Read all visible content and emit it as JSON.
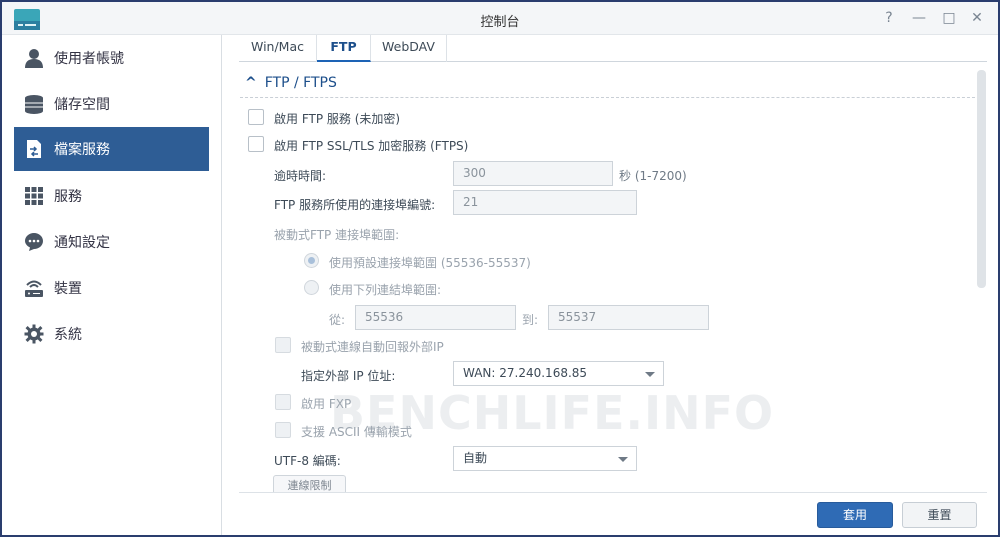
{
  "window": {
    "title": "控制台"
  },
  "window_controls": {
    "help": "?",
    "minimize": "—",
    "maximize": "□",
    "close": "✕"
  },
  "sidebar": {
    "items": [
      {
        "label": "使用者帳號",
        "icon": "user-icon",
        "active": false
      },
      {
        "label": "儲存空間",
        "icon": "storage-icon",
        "active": false
      },
      {
        "label": "檔案服務",
        "icon": "file-services-icon",
        "active": true
      },
      {
        "label": "服務",
        "icon": "services-grid-icon",
        "active": false
      },
      {
        "label": "通知設定",
        "icon": "chat-bubble-icon",
        "active": false
      },
      {
        "label": "裝置",
        "icon": "router-icon",
        "active": false
      },
      {
        "label": "系統",
        "icon": "gear-icon",
        "active": false
      }
    ]
  },
  "tabs": [
    {
      "label": "Win/Mac",
      "active": false
    },
    {
      "label": "FTP",
      "active": true
    },
    {
      "label": "WebDAV",
      "active": false
    }
  ],
  "section": {
    "toggle": "^",
    "title": "FTP / FTPS",
    "enable_ftp": "啟用 FTP 服務 (未加密)",
    "enable_ftps": "啟用 FTP SSL/TLS 加密服務 (FTPS)",
    "timeout_label": "逾時時間:",
    "timeout_value": "300",
    "timeout_unit": "秒 (1-7200)",
    "port_label": "FTP 服務所使用的連接埠編號:",
    "port_value": "21",
    "passive_label": "被動式FTP 連接埠範圍:",
    "radio_default": "使用預設連接埠範圍 (55536-55537)",
    "radio_custom": "使用下列連結埠範圍:",
    "from_label": "從:",
    "from_value": "55536",
    "to_label": "到:",
    "to_value": "55537",
    "report_ip": "被動式連線自動回報外部IP",
    "ext_ip_label": "指定外部 IP 位址:",
    "ext_ip_value": "WAN: 27.240.168.85",
    "enable_fxp": "啟用 FXP",
    "ascii_mode": "支援 ASCII 傳輸模式",
    "utf8_label": "UTF-8 編碼:",
    "utf8_value": "自動",
    "partial_button": "連線限制"
  },
  "watermark": "BENCHLIFE.INFO",
  "footer": {
    "apply": "套用",
    "reset": "重置"
  },
  "colors": {
    "accent": "#2f6bb5",
    "sidebar_active": "#2e5d95",
    "frame": "#2a3d6e"
  }
}
